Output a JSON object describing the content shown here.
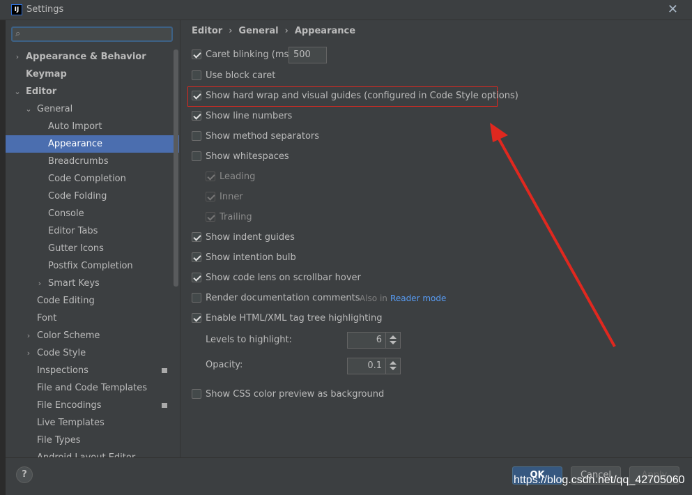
{
  "window": {
    "title": "Settings",
    "logo_text": "IJ"
  },
  "search": {
    "placeholder": "",
    "icon": "search-icon"
  },
  "tree": [
    {
      "label": "Appearance & Behavior",
      "bold": true,
      "arrow": "›",
      "level": 0
    },
    {
      "label": "Keymap",
      "bold": true,
      "arrow": "",
      "level": 0
    },
    {
      "label": "Editor",
      "bold": true,
      "arrow": "⌄",
      "level": 0
    },
    {
      "label": "General",
      "bold": false,
      "arrow": "⌄",
      "level": 1
    },
    {
      "label": "Auto Import",
      "level": 2
    },
    {
      "label": "Appearance",
      "level": 2,
      "selected": true
    },
    {
      "label": "Breadcrumbs",
      "level": 2
    },
    {
      "label": "Code Completion",
      "level": 2
    },
    {
      "label": "Code Folding",
      "level": 2
    },
    {
      "label": "Console",
      "level": 2
    },
    {
      "label": "Editor Tabs",
      "level": 2
    },
    {
      "label": "Gutter Icons",
      "level": 2
    },
    {
      "label": "Postfix Completion",
      "level": 2
    },
    {
      "label": "Smart Keys",
      "level": 2,
      "arrow": "›"
    },
    {
      "label": "Code Editing",
      "level": 1
    },
    {
      "label": "Font",
      "level": 1
    },
    {
      "label": "Color Scheme",
      "level": 1,
      "arrow": "›"
    },
    {
      "label": "Code Style",
      "level": 1,
      "arrow": "›"
    },
    {
      "label": "Inspections",
      "level": 1,
      "badge": true
    },
    {
      "label": "File and Code Templates",
      "level": 1
    },
    {
      "label": "File Encodings",
      "level": 1,
      "badge": true
    },
    {
      "label": "Live Templates",
      "level": 1
    },
    {
      "label": "File Types",
      "level": 1
    },
    {
      "label": "Android Layout Editor",
      "level": 1
    }
  ],
  "breadcrumb": [
    "Editor",
    "General",
    "Appearance"
  ],
  "options": {
    "caret_blinking": {
      "label": "Caret blinking (ms):",
      "checked": true,
      "value": "500"
    },
    "use_block_caret": {
      "label": "Use block caret",
      "checked": false
    },
    "hard_wrap": {
      "label": "Show hard wrap and visual guides (configured in Code Style options)",
      "checked": true
    },
    "line_numbers": {
      "label": "Show line numbers",
      "checked": true
    },
    "method_separators": {
      "label": "Show method separators",
      "checked": false
    },
    "whitespaces": {
      "label": "Show whitespaces",
      "checked": false
    },
    "leading": {
      "label": "Leading",
      "checked": true,
      "disabled": true
    },
    "inner": {
      "label": "Inner",
      "checked": true,
      "disabled": true
    },
    "trailing": {
      "label": "Trailing",
      "checked": true,
      "disabled": true
    },
    "indent_guides": {
      "label": "Show indent guides",
      "checked": true
    },
    "intention_bulb": {
      "label": "Show intention bulb",
      "checked": true
    },
    "code_lens": {
      "label": "Show code lens on scrollbar hover",
      "checked": true
    },
    "render_docs": {
      "label": "Render documentation comments",
      "checked": false,
      "hint": "Also in",
      "link": "Reader mode"
    },
    "tag_tree": {
      "label": "Enable HTML/XML tag tree highlighting",
      "checked": true
    },
    "levels": {
      "label": "Levels to highlight:",
      "value": "6"
    },
    "opacity": {
      "label": "Opacity:",
      "value": "0.1"
    },
    "css_preview": {
      "label": "Show CSS color preview as background",
      "checked": false
    }
  },
  "buttons": {
    "help": "?",
    "ok": "OK",
    "cancel": "Cancel",
    "apply": "Apply"
  },
  "watermark": "https://blog.csdn.net/qq_42705060",
  "colors": {
    "accent": "#4b6eaf",
    "annotation": "#e0281f",
    "link": "#589df6"
  }
}
